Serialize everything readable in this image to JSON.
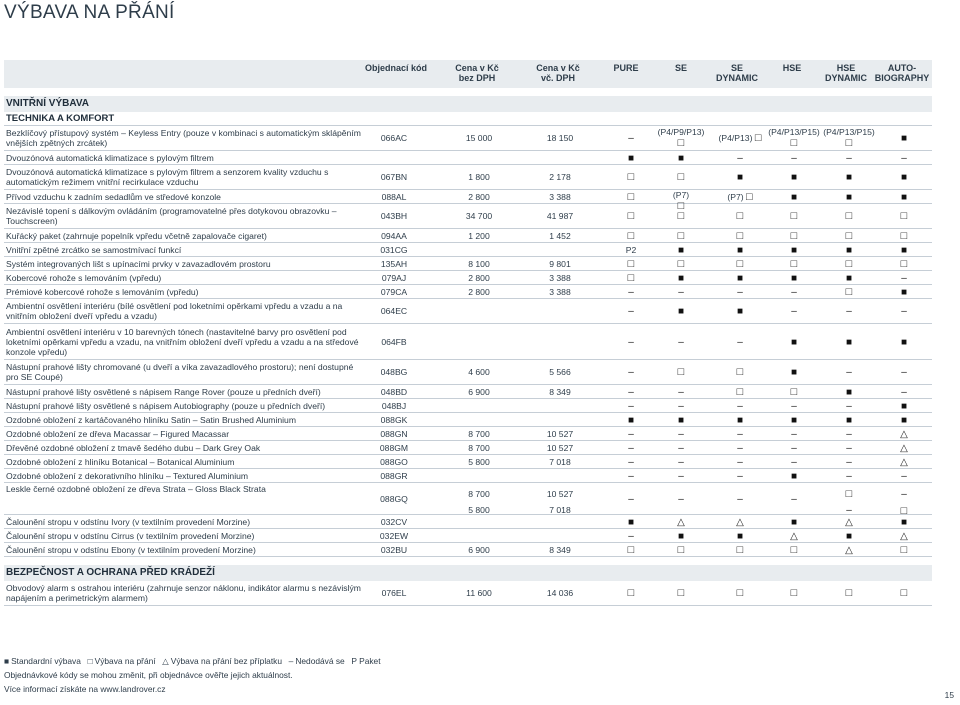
{
  "title": "VÝBAVA NA PŘÁNÍ",
  "columns": {
    "code": "Objednací kód",
    "price_ex": "Cena v Kč\nbez DPH",
    "price_inc": "Cena v Kč\nvč. DPH",
    "pure": "PURE",
    "se": "SE",
    "se_dynamic": "SE\nDYNAMIC",
    "hse": "HSE",
    "hse_dynamic": "HSE\nDYNAMIC",
    "autobiography": "AUTO-\nBIOGRAPHY"
  },
  "sections": {
    "interior": "VNITŘNÍ VÝBAVA",
    "tech": "TECHNIKA A KOMFORT",
    "security": "BEZPEČNOST A OCHRANA PŘED KRÁDEŽÍ"
  },
  "rows": [
    {
      "desc": "Bezklíčový přístupový systém – Keyless Entry (pouze v kombinaci s automatickým sklápěním vnějších zpětných zrcátek)",
      "code": "066AC",
      "p1": "15 000",
      "p2": "18 150",
      "m": [
        "dash",
        "(P4/P9/P13)|empty",
        "(P4/P13)|empty",
        "(P4/P13/P15)|empty",
        "(P4/P13/P15)|empty",
        "full"
      ]
    },
    {
      "desc": "Dvouzónová automatická klimatizace s pylovým filtrem",
      "code": "",
      "p1": "",
      "p2": "",
      "m": [
        "full",
        "full",
        "dash",
        "dash",
        "dash",
        "dash"
      ]
    },
    {
      "desc": "Dvouzónová automatická klimatizace s pylovým filtrem a senzorem kvality vzduchu s automatickým režimem vnitřní recirkulace vzduchu",
      "code": "067BN",
      "p1": "1 800",
      "p2": "2 178",
      "m": [
        "empty",
        "empty",
        "full",
        "full",
        "full",
        "full"
      ]
    },
    {
      "desc": "Přívod vzduchu k zadním sedadlům ve středové konzole",
      "code": "088AL",
      "p1": "2 800",
      "p2": "3 388",
      "m": [
        "empty",
        "(P7)|empty",
        "(P7)|empty",
        "full",
        "full",
        "full"
      ]
    },
    {
      "desc": "Nezávislé topení s dálkovým ovládáním (programovatelné přes dotykovou obrazovku – Touchscreen)",
      "code": "043BH",
      "p1": "34 700",
      "p2": "41 987",
      "m": [
        "empty",
        "empty",
        "empty",
        "empty",
        "empty",
        "empty"
      ]
    },
    {
      "desc": "Kuřácký paket (zahrnuje popelník vpředu včetně zapalovače cigaret)",
      "code": "094AA",
      "p1": "1 200",
      "p2": "1 452",
      "m": [
        "empty",
        "empty",
        "empty",
        "empty",
        "empty",
        "empty"
      ]
    },
    {
      "desc": "Vnitřní zpětné zrcátko se samostmívací funkcí",
      "code": "031CG",
      "p1": "",
      "p2": "",
      "m": [
        "P2",
        "full",
        "full",
        "full",
        "full",
        "full"
      ]
    },
    {
      "desc": "Systém integrovaných lišt s upínacími prvky v zavazadlovém prostoru",
      "code": "135AH",
      "p1": "8 100",
      "p2": "9 801",
      "m": [
        "empty",
        "empty",
        "empty",
        "empty",
        "empty",
        "empty"
      ]
    },
    {
      "desc": "Kobercové rohože s lemováním (vpředu)",
      "code": "079AJ",
      "p1": "2 800",
      "p2": "3 388",
      "m": [
        "empty",
        "full",
        "full",
        "full",
        "full",
        "dash"
      ]
    },
    {
      "desc": "Prémiové kobercové rohože s lemováním (vpředu)",
      "code": "079CA",
      "p1": "2 800",
      "p2": "3 388",
      "m": [
        "dash",
        "dash",
        "dash",
        "dash",
        "empty",
        "full"
      ]
    },
    {
      "desc": "Ambientní osvětlení interiéru (bílé osvětlení pod loketními opěrkami vpředu a vzadu a na vnitřním obložení dveří vpředu a vzadu)",
      "code": "064EC",
      "p1": "",
      "p2": "",
      "m": [
        "dash",
        "full",
        "full",
        "dash",
        "dash",
        "dash"
      ]
    },
    {
      "desc": "Ambientní osvětlení interiéru v 10 barevných tónech (nastavitelné barvy pro osvětlení pod loketními opěrkami vpředu a vzadu, na vnitřním obložení dveří vpředu a vzadu a na středové konzole vpředu)",
      "code": "064FB",
      "p1": "",
      "p2": "",
      "m": [
        "dash",
        "dash",
        "dash",
        "full",
        "full",
        "full"
      ]
    },
    {
      "desc": "Nástupní prahové lišty chromované (u dveří a víka zavazadlového prostoru); není dostupné pro SE Coupé)",
      "code": "048BG",
      "p1": "4 600",
      "p2": "5 566",
      "m": [
        "dash",
        "empty",
        "empty",
        "full",
        "dash",
        "dash"
      ]
    },
    {
      "desc": "Nástupní prahové lišty osvětlené s nápisem Range Rover (pouze u předních dveří)",
      "code": "048BD",
      "p1": "6 900",
      "p2": "8 349",
      "m": [
        "dash",
        "dash",
        "empty",
        "empty",
        "full",
        "dash"
      ]
    },
    {
      "desc": "Nástupní prahové lišty osvětlené s nápisem Autobiography (pouze u předních dveří)",
      "code": "048BJ",
      "p1": "",
      "p2": "",
      "m": [
        "dash",
        "dash",
        "dash",
        "dash",
        "dash",
        "full"
      ]
    },
    {
      "desc": "Ozdobné obložení z kartáčovaného hliníku Satin – Satin Brushed Aluminium",
      "code": "088GK",
      "p1": "",
      "p2": "",
      "m": [
        "full",
        "full",
        "full",
        "full",
        "full",
        "full"
      ]
    },
    {
      "desc": "Ozdobné obložení ze dřeva Macassar – Figured Macassar",
      "code": "088GN",
      "p1": "8 700",
      "p2": "10 527",
      "m": [
        "dash",
        "dash",
        "dash",
        "dash",
        "dash",
        "tri"
      ]
    },
    {
      "desc": "Dřevěné ozdobné obložení z tmavě šedého dubu – Dark Grey Oak",
      "code": "088GM",
      "p1": "8 700",
      "p2": "10 527",
      "m": [
        "dash",
        "dash",
        "dash",
        "dash",
        "dash",
        "tri"
      ]
    },
    {
      "desc": "Ozdobné obložení z hliníku Botanical – Botanical Aluminium",
      "code": "088GO",
      "p1": "5 800",
      "p2": "7 018",
      "m": [
        "dash",
        "dash",
        "dash",
        "dash",
        "dash",
        "tri"
      ]
    },
    {
      "desc": "Ozdobné obložení z dekorativního hliníku – Textured Aluminium",
      "code": "088GR",
      "p1": "",
      "p2": "",
      "m": [
        "dash",
        "dash",
        "dash",
        "full",
        "dash",
        "dash"
      ]
    },
    {
      "desc": "Leskle černé ozdobné obložení ze dřeva Strata – Gloss Black Strata",
      "code": "088GQ",
      "p1": "8 700|5 800",
      "p2": "10 527|7 018",
      "m": [
        "dash",
        "dash",
        "dash",
        "dash",
        "empty|dash",
        "dash|empty"
      ]
    },
    {
      "desc": "Čalounění stropu v odstínu Ivory (v textilním provedení Morzine)",
      "code": "032CV",
      "p1": "",
      "p2": "",
      "m": [
        "full",
        "tri",
        "tri",
        "full",
        "tri",
        "full"
      ]
    },
    {
      "desc": "Čalounění stropu v odstínu Cirrus (v textilním provedení Morzine)",
      "code": "032EW",
      "p1": "",
      "p2": "",
      "m": [
        "dash",
        "full",
        "full",
        "tri",
        "full",
        "tri"
      ]
    },
    {
      "desc": "Čalounění stropu v odstínu Ebony (v textilním provedení Morzine)",
      "code": "032BU",
      "p1": "6 900",
      "p2": "8 349",
      "m": [
        "empty",
        "empty",
        "empty",
        "empty",
        "tri",
        "empty"
      ]
    }
  ],
  "security_rows": [
    {
      "desc": "Obvodový alarm s ostrahou interiéru (zahrnuje senzor náklonu, indikátor alarmu s nezávislým napájením a perimetrickým alarmem)",
      "code": "076EL",
      "p1": "11 600",
      "p2": "14 036",
      "m": [
        "empty",
        "empty",
        "empty",
        "empty",
        "empty",
        "empty"
      ]
    }
  ],
  "legend": {
    "standard": "Standardní výbava",
    "option": "Výbava na přání",
    "option_extra": "Výbava na přání bez příplatku",
    "na": "Nedodává se",
    "pkg": "P Paket"
  },
  "notes": {
    "n1": "Objednávkové kódy se mohou změnit, při objednávce ověřte jejich aktuálnost.",
    "n2": "Více informací získáte na www.landrover.cz"
  },
  "page_number": "15"
}
